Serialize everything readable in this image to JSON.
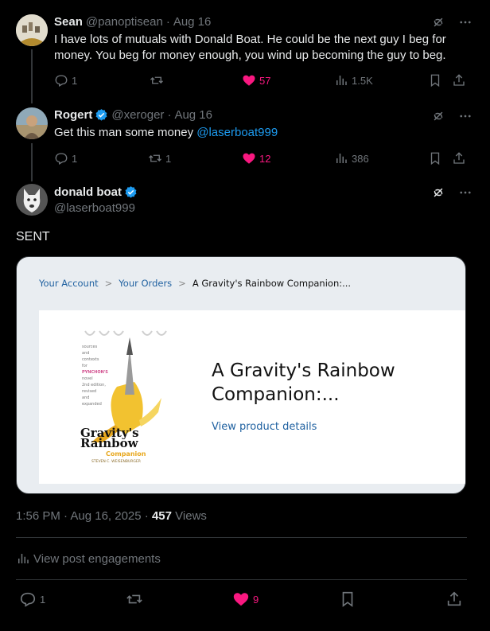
{
  "tweets": [
    {
      "name": "Sean",
      "handle": "@panoptisean",
      "sep": "·",
      "date": "Aug 16",
      "text": "I have lots of mutuals with Donald Boat. He could be the next guy I beg for money. You beg for money enough, you wind up becoming the guy to beg.",
      "replies": "1",
      "retweets": "",
      "likes": "57",
      "views": "1.5K"
    },
    {
      "name": "Rogert",
      "handle": "@xeroger",
      "sep": "·",
      "date": "Aug 16",
      "text_prefix": "Get this man some money ",
      "mention": "@laserboat999",
      "replies": "1",
      "retweets": "1",
      "likes": "12",
      "views": "386"
    }
  ],
  "main": {
    "name": "donald boat",
    "handle": "@laserboat999",
    "text": "SENT",
    "timestamp": "1:56 PM · Aug 16, 2025 · ",
    "views_count": "457",
    "views_label": "Views",
    "engagements": "View post engagements",
    "replies": "1",
    "likes": "9"
  },
  "card": {
    "crumbs": [
      "Your Account",
      "Your Orders",
      "A Gravity's Rainbow Companion:..."
    ],
    "crumb_sep": ">",
    "product_title": "A Gravity's Rainbow Companion:...",
    "product_link": "View product details",
    "book": {
      "lines": [
        "sources",
        "and",
        "contexts",
        "for",
        "PYNCHON'S",
        "novel",
        "2nd edition,",
        "revised",
        "and",
        "expanded"
      ],
      "title1": "Gravity's",
      "title2": "Rainbow",
      "subtitle": "Companion",
      "author": "STEVEN C. WEISENBURGER"
    }
  },
  "colors": {
    "like": "#f91880",
    "link": "#1d9bf0",
    "verified": "#1d9bf0"
  }
}
